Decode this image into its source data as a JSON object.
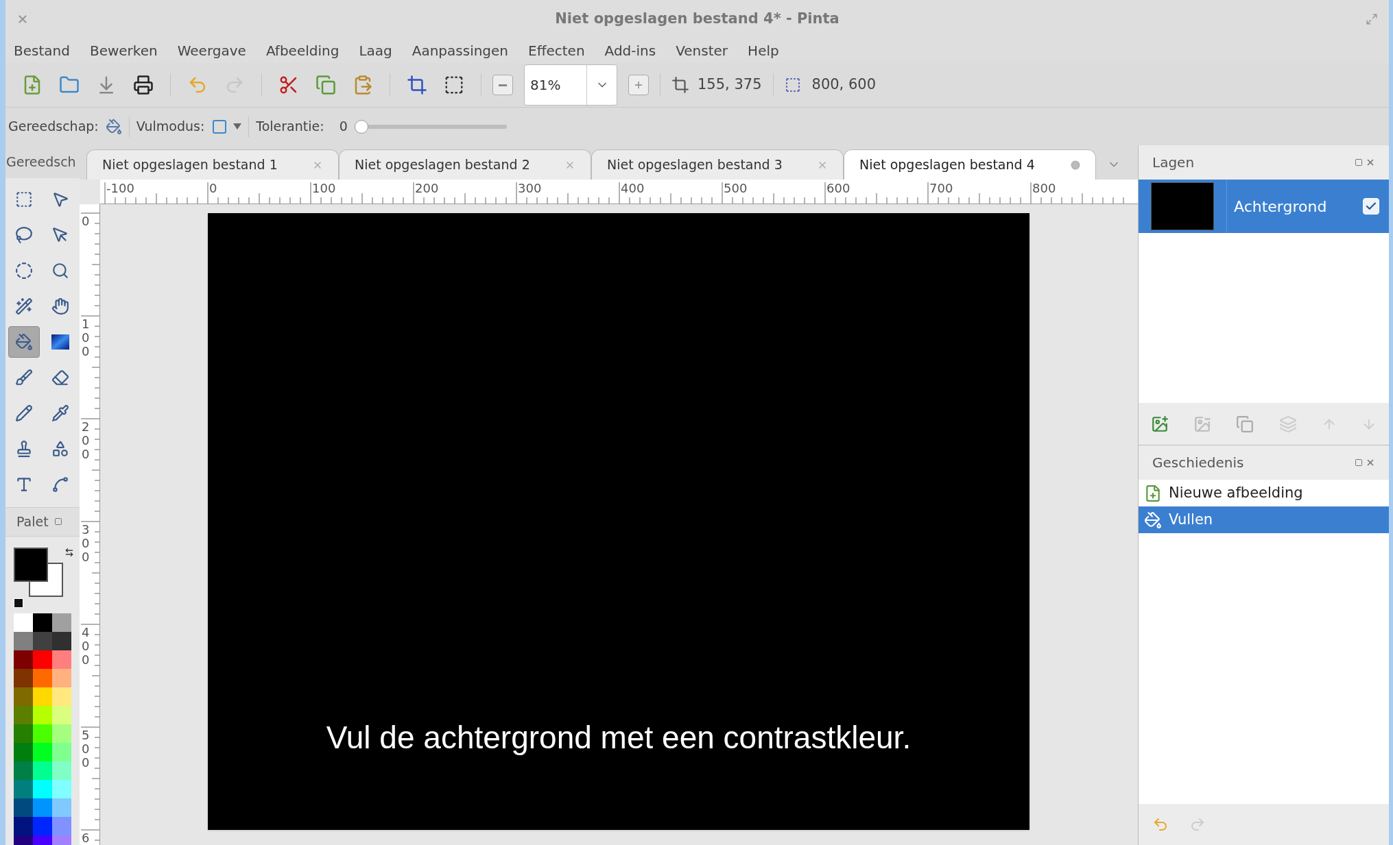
{
  "window": {
    "title": "Niet opgeslagen bestand 4* - Pinta"
  },
  "menu": [
    "Bestand",
    "Bewerken",
    "Weergave",
    "Afbeelding",
    "Laag",
    "Aanpassingen",
    "Effecten",
    "Add-ins",
    "Venster",
    "Help"
  ],
  "toolbar": {
    "zoom": "81%",
    "cursor_position": "155, 375",
    "selection_size": "800, 600"
  },
  "tool_options": {
    "tool_label": "Gereedschap:",
    "fill_mode_label": "Vulmodus:",
    "tolerance_label": "Tolerantie:",
    "tolerance_value": "0",
    "tolerance": {
      "level": 0
    }
  },
  "toolbox": {
    "title": "Gereedsch",
    "tools": [
      {
        "selected": false
      },
      {
        "selected": false
      },
      {
        "selected": false
      },
      {
        "selected": false
      },
      {
        "selected": false
      },
      {
        "selected": false
      },
      {
        "selected": false
      },
      {
        "selected": false
      },
      {
        "selected": true
      },
      {
        "selected": false
      },
      {
        "selected": false
      },
      {
        "selected": false
      },
      {
        "selected": false
      },
      {
        "selected": false
      },
      {
        "selected": false
      },
      {
        "selected": false
      },
      {
        "selected": false
      },
      {
        "selected": false
      }
    ]
  },
  "palette": {
    "title": "Palet",
    "current_colors": [
      {
        "color": "#000000"
      },
      {
        "color": "#ffffff"
      }
    ],
    "swatches": [
      {
        "color": "#ffffff"
      },
      {
        "color": "#000000"
      },
      {
        "color": "#a0a0a0"
      },
      {
        "color": "#808080"
      },
      {
        "color": "#404040"
      },
      {
        "color": "#303030"
      },
      {
        "color": "#7f0000"
      },
      {
        "color": "#ff0000"
      },
      {
        "color": "#ff7f7f"
      },
      {
        "color": "#7f3300"
      },
      {
        "color": "#ff6a00"
      },
      {
        "color": "#ffb27f"
      },
      {
        "color": "#7f6a00"
      },
      {
        "color": "#ffd800"
      },
      {
        "color": "#ffe97f"
      },
      {
        "color": "#5b7f00"
      },
      {
        "color": "#b6ff00"
      },
      {
        "color": "#daff7f"
      },
      {
        "color": "#267f00"
      },
      {
        "color": "#4cff00"
      },
      {
        "color": "#a5ff7f"
      },
      {
        "color": "#007f0e"
      },
      {
        "color": "#00ff21"
      },
      {
        "color": "#7fff8e"
      },
      {
        "color": "#007f46"
      },
      {
        "color": "#00ff90"
      },
      {
        "color": "#7fffc5"
      },
      {
        "color": "#007f7f"
      },
      {
        "color": "#00ffff"
      },
      {
        "color": "#7fffff"
      },
      {
        "color": "#004a7f"
      },
      {
        "color": "#0094ff"
      },
      {
        "color": "#7fc9ff"
      },
      {
        "color": "#00137f"
      },
      {
        "color": "#0026ff"
      },
      {
        "color": "#7f92ff"
      },
      {
        "color": "#21007f"
      },
      {
        "color": "#4800ff"
      },
      {
        "color": "#a17fff"
      }
    ]
  },
  "tabs": [
    {
      "label": "Niet opgeslagen bestand 1",
      "selected": false,
      "modified": false
    },
    {
      "label": "Niet opgeslagen bestand 2",
      "selected": false,
      "modified": false
    },
    {
      "label": "Niet opgeslagen bestand 3",
      "selected": false,
      "modified": false
    },
    {
      "label": "Niet opgeslagen bestand 4",
      "selected": true,
      "modified": true
    }
  ],
  "rulers": {
    "horizontal": [
      "-100",
      "0",
      "100",
      "200",
      "300",
      "400",
      "500",
      "600",
      "700",
      "800"
    ],
    "vertical": [
      "0",
      "100",
      "200",
      "300",
      "400",
      "500",
      "6"
    ]
  },
  "canvas": {
    "caption": "Vul de achtergrond met een contrastkleur."
  },
  "layers": {
    "title": "Lagen",
    "items": [
      {
        "name": "Achtergrond",
        "selected": true,
        "visible": true
      }
    ]
  },
  "history": {
    "title": "Geschiedenis",
    "items": [
      {
        "label": "Nieuwe afbeelding",
        "selected": false,
        "kind": "new"
      },
      {
        "label": "Vullen",
        "selected": true,
        "kind": "fill"
      }
    ]
  }
}
